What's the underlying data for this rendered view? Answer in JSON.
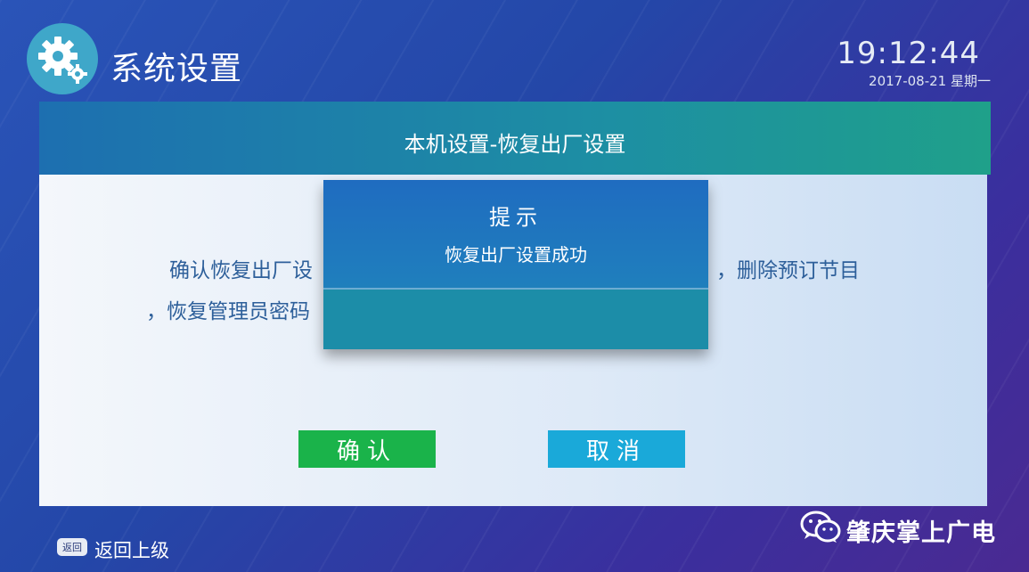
{
  "header": {
    "icon": "gear-icon",
    "title": "系统设置"
  },
  "clock": {
    "time": "19:12:44",
    "date": "2017-08-21 星期一"
  },
  "panel": {
    "title": "本机设置-恢复出厂设置",
    "body_line1_start": "确认恢复出厂设",
    "body_line1_end": "，删除预订节目",
    "body_line2": "，恢复管理员密码",
    "confirm_label": "确认",
    "cancel_label": "取消"
  },
  "dialog": {
    "title": "提示",
    "message": "恢复出厂设置成功"
  },
  "footer": {
    "back_icon_text": "返回",
    "back_label": "返回上级"
  },
  "watermark": {
    "icon": "wechat-icon",
    "text": "肇庆掌上广电"
  },
  "colors": {
    "confirm": "#1ab34a",
    "cancel": "#1aa9d9",
    "header_bar": "#1d8fa3",
    "dialog": "#1f6cc0"
  }
}
